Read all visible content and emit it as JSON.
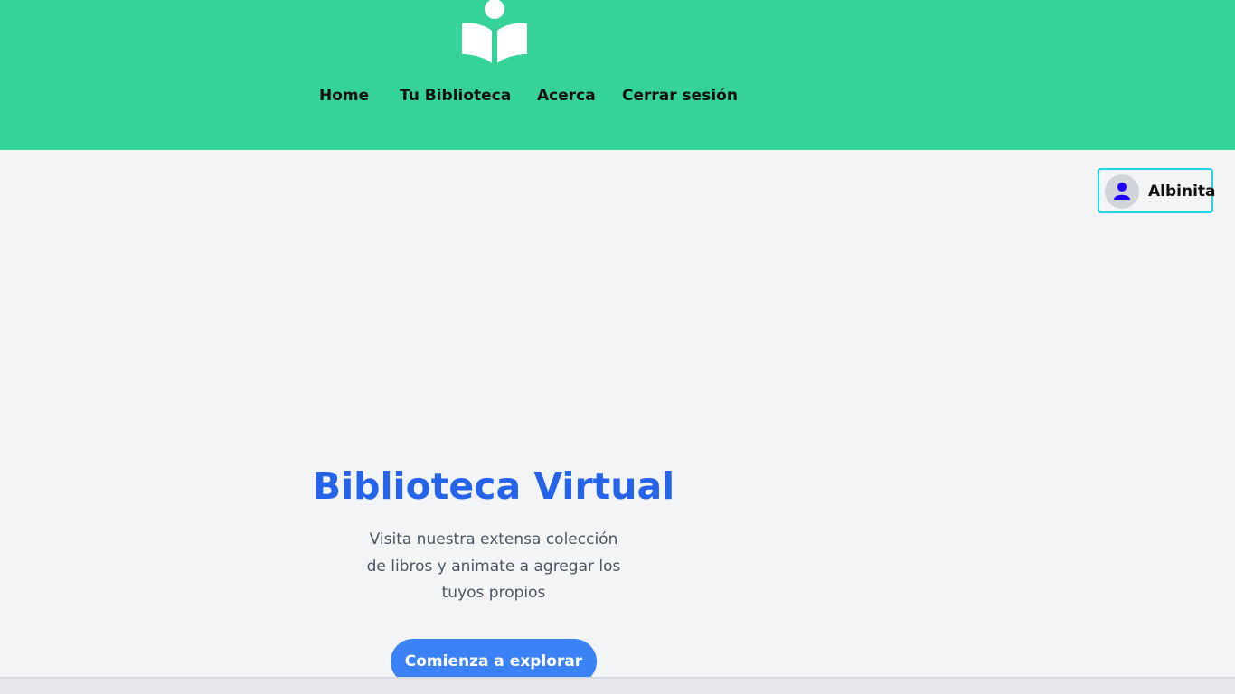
{
  "colors": {
    "header_bg": "#36d399",
    "page_bg": "#f3f4f6",
    "title_color": "#2563eb",
    "cta_bg": "#3b82f6",
    "badge_border": "#22d3ee",
    "avatar_icon": "#1d00ff"
  },
  "header": {
    "logo_icon": "book-reader-icon",
    "nav": [
      {
        "label": "Home"
      },
      {
        "label": "Tu Biblioteca"
      },
      {
        "label": "Acerca"
      },
      {
        "label": "Cerrar sesión"
      }
    ]
  },
  "user": {
    "avatar_icon": "user-icon",
    "name": "Albinita"
  },
  "hero": {
    "title": "Biblioteca Virtual",
    "description_lines": [
      "Visita nuestra extensa colección",
      "de libros y animate a agregar los",
      "tuyos propios"
    ],
    "cta_label": "Comienza a explorar"
  }
}
